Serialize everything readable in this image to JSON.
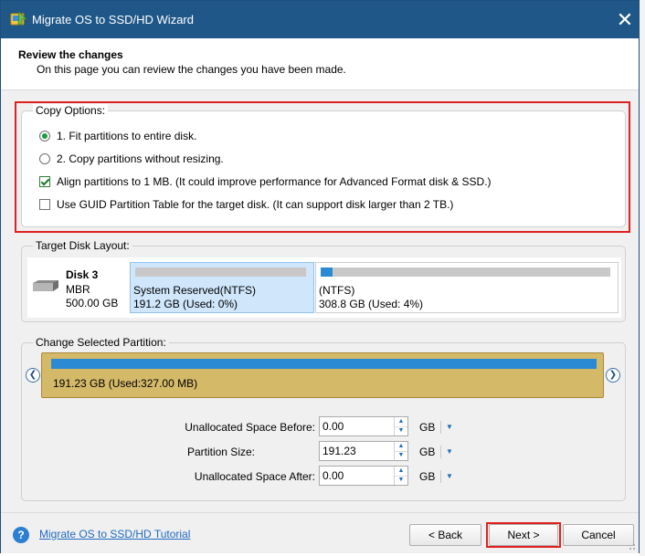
{
  "window": {
    "title": "Migrate OS to SSD/HD Wizard",
    "close_glyph": "✕",
    "title_bar_color": "#1f5788"
  },
  "header": {
    "title": "Review the changes",
    "description": "On this page you can review the changes you have been made."
  },
  "copy_options": {
    "legend": "Copy Options:",
    "options": [
      {
        "type": "radio",
        "label": "1. Fit partitions to entire disk.",
        "checked": true
      },
      {
        "type": "radio",
        "label": "2. Copy partitions without resizing.",
        "checked": false
      },
      {
        "type": "checkbox",
        "label": "Align partitions to 1 MB.  (It could improve performance for Advanced Format disk & SSD.)",
        "checked": true
      },
      {
        "type": "checkbox",
        "label": "Use GUID Partition Table for the target disk. (It can support disk larger than 2 TB.)",
        "checked": false
      }
    ],
    "highlight_color": "#e02020"
  },
  "target_disk": {
    "legend": "Target Disk Layout:",
    "disk_name": "Disk 3",
    "disk_type": "MBR",
    "disk_size": "500.00 GB",
    "partitions": [
      {
        "name": "System Reserved(NTFS)",
        "info": "191.2 GB (Used: 0%)",
        "selected": true,
        "used_fraction": 0.0
      },
      {
        "name": "(NTFS)",
        "info": "308.8 GB (Used: 4%)",
        "selected": false,
        "used_fraction": 0.04
      }
    ]
  },
  "change_partition": {
    "legend": "Change Selected Partition:",
    "left_arrow": "❮",
    "right_arrow": "❯",
    "partition_label": "191.23 GB (Used:327.00 MB)",
    "fields": [
      {
        "label": "Unallocated Space Before:",
        "value": "0.00",
        "unit": "GB"
      },
      {
        "label": "Partition Size:",
        "value": "191.23",
        "unit": "GB"
      },
      {
        "label": "Unallocated Space After:",
        "value": "0.00",
        "unit": "GB"
      }
    ],
    "spin_up": "▲",
    "spin_down": "▼",
    "unit_dropdown": "▼"
  },
  "footer": {
    "help_glyph": "?",
    "tutorial_link": "Migrate OS to SSD/HD Tutorial",
    "back_label": "< Back",
    "next_label": "Next >",
    "cancel_label": "Cancel"
  }
}
